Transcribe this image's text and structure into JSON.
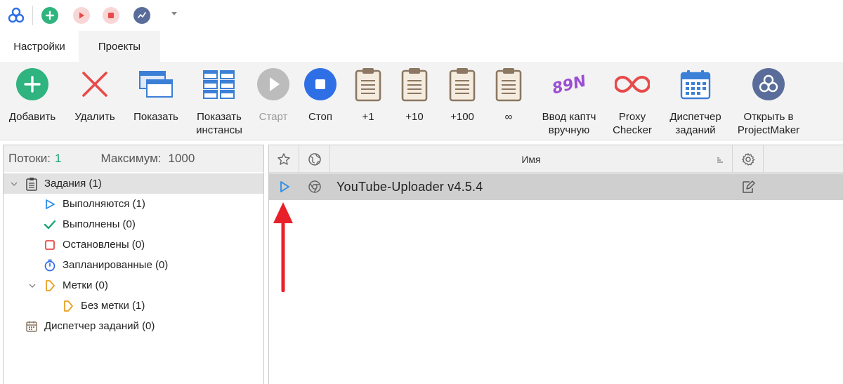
{
  "tabs": {
    "settings": "Настройки",
    "projects": "Проекты"
  },
  "ribbon": {
    "add": "Добавить",
    "delete": "Удалить",
    "show": "Показать",
    "show_instances_1": "Показать",
    "show_instances_2": "инстансы",
    "start": "Старт",
    "stop": "Стоп",
    "plus1": "+1",
    "plus10": "+10",
    "plus100": "+100",
    "infinite": "∞",
    "captcha_1": "Ввод каптч",
    "captcha_2": "вручную",
    "captcha_icon_text": "89N",
    "proxy_1": "Proxy",
    "proxy_2": "Checker",
    "scheduler_1": "Диспетчер",
    "scheduler_2": "заданий",
    "open_pm_1": "Открыть в",
    "open_pm_2": "ProjectMaker"
  },
  "threads": {
    "label": "Потоки:",
    "value": "1",
    "max_label": "Максимум:",
    "max_value": "1000"
  },
  "tree": {
    "tasks": "Задания (1)",
    "running": "Выполняются (1)",
    "done": "Выполнены (0)",
    "stopped": "Остановлены (0)",
    "scheduled": "Запланированные (0)",
    "tags": "Метки (0)",
    "no_tag": "Без метки (1)",
    "scheduler": "Диспетчер заданий (0)"
  },
  "grid": {
    "col_name": "Имя",
    "rows": [
      {
        "name": "YouTube-Uploader v4.5.4",
        "status": "running"
      }
    ]
  },
  "colors": {
    "accent_green": "#2fb37f",
    "accent_red": "#e84a4a",
    "accent_blue": "#2f6fe6",
    "play_blue": "#2a8de6",
    "ribbon_bg": "#f3f3f3",
    "arrow_red": "#e8202a"
  }
}
